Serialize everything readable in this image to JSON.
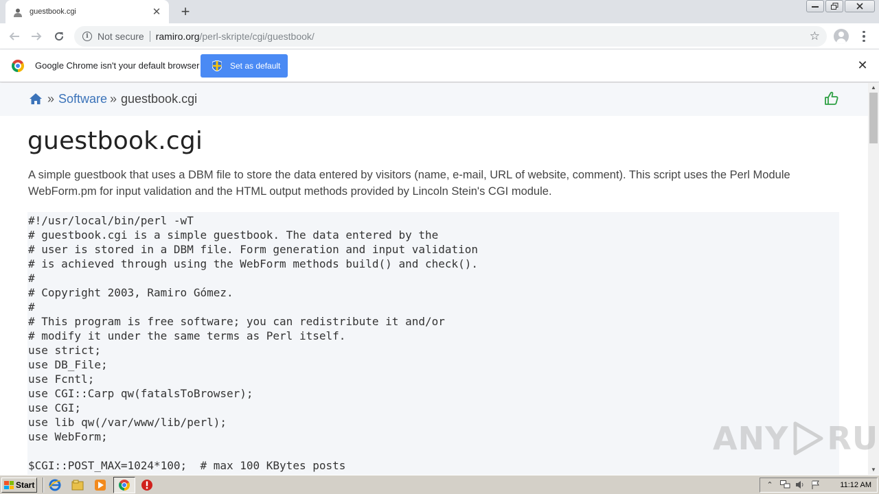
{
  "browser": {
    "tab": {
      "title": "guestbook.cgi"
    },
    "omnibox": {
      "security_label": "Not secure",
      "url_host": "ramiro.org",
      "url_path": "/perl-skripte/cgi/guestbook/"
    },
    "icons": {
      "back": "back-arrow-icon",
      "forward": "forward-arrow-icon",
      "reload": "reload-icon",
      "bookmark": "star-icon",
      "menu": "three-dots-icon"
    }
  },
  "infobar": {
    "message": "Google Chrome isn't your default browser",
    "button_label": "Set as default"
  },
  "page": {
    "breadcrumb": {
      "separator": "»",
      "link_label": "Software",
      "current": "guestbook.cgi"
    },
    "title": "guestbook.cgi",
    "description": "A simple guestbook that uses a DBM file to store the data entered by visitors (name, e-mail, URL of website, comment). This script uses the Perl Module WebForm.pm for input validation and the HTML output methods provided by Lincoln Stein's CGI module.",
    "code": "#!/usr/local/bin/perl -wT\n# guestbook.cgi is a simple guestbook. The data entered by the\n# user is stored in a DBM file. Form generation and input validation\n# is achieved through using the WebForm methods build() and check().\n#\n# Copyright 2003, Ramiro Gómez.\n#\n# This program is free software; you can redistribute it and/or\n# modify it under the same terms as Perl itself.\nuse strict;\nuse DB_File;\nuse Fcntl;\nuse CGI::Carp qw(fatalsToBrowser);\nuse CGI;\nuse lib qw(/var/www/lib/perl);\nuse WebForm;\n\n$CGI::POST_MAX=1024*100;  # max 100 KBytes posts"
  },
  "watermark": {
    "left": "ANY",
    "right": "RUN"
  },
  "taskbar": {
    "start_label": "Start",
    "clock": "11:12 AM"
  },
  "colors": {
    "accent_blue": "#4a8af4",
    "link_blue": "#3b73b9",
    "thumb_green": "#2ea043",
    "code_bg": "#f4f6f9"
  }
}
